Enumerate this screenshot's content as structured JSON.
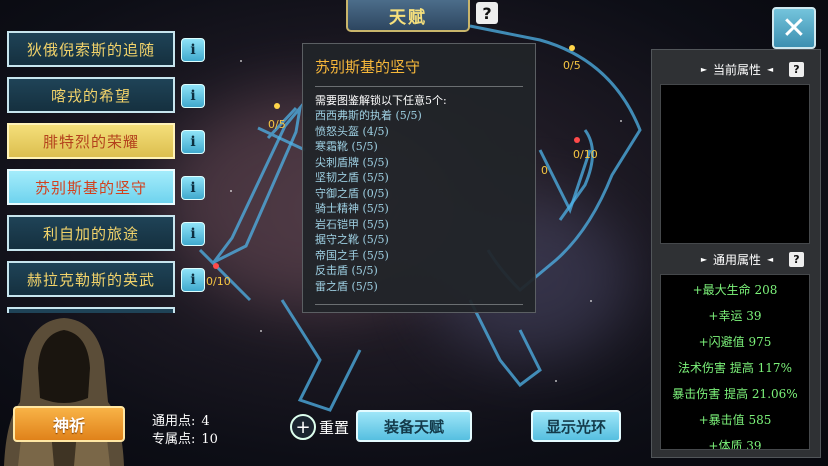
{
  "header": {
    "title": "天赋",
    "help_icon": "question-icon"
  },
  "close_icon": "close-icon",
  "talents": [
    {
      "label": "狄俄倪索斯的追随",
      "style": "normal"
    },
    {
      "label": "喀戎的希望",
      "style": "normal"
    },
    {
      "label": "腓特烈的荣耀",
      "style": "gold"
    },
    {
      "label": "苏别斯基的坚守",
      "style": "cyan"
    },
    {
      "label": "利自加的旅途",
      "style": "normal"
    },
    {
      "label": "赫拉克勒斯的英武",
      "style": "normal"
    }
  ],
  "info_label": "i",
  "constellation_points": {
    "top": "0/5",
    "left_upper": "0/5",
    "right": "0/10",
    "right_mid": "0",
    "left_lower": "0/10"
  },
  "popup": {
    "title": "苏别斯基的坚守",
    "requirement": "需要图鉴解锁以下任意5个:",
    "items": [
      "西西弗斯的执着 (5/5)",
      "愤怒头盔 (4/5)",
      "寒霜靴 (5/5)",
      "尖刺盾牌 (5/5)",
      "坚韧之盾 (5/5)",
      "守御之盾 (0/5)",
      "骑士精神 (5/5)",
      "岩石铠甲 (5/5)",
      "据守之靴 (5/5)",
      "帝国之手 (5/5)",
      "反击盾 (5/5)",
      "雷之盾 (5/5)"
    ]
  },
  "right_panel": {
    "current_attr_title": "当前属性",
    "general_attr_title": "通用属性",
    "stats": [
      "+最大生命 208",
      "+幸运 39",
      "+闪避值 975",
      "法术伤害 提高 117%",
      "暴击伤害 提高 21.06%",
      "+暴击值 585",
      "+体质 39"
    ]
  },
  "bottom": {
    "pray_label": "神祈",
    "general_points_label": "通用点:",
    "general_points_value": "4",
    "special_points_label": "专属点:",
    "special_points_value": "10",
    "reset_label": "重置",
    "equip_label": "装备天赋",
    "show_aura_label": "显示光环"
  },
  "colors": {
    "accent_gold": "#f6e07c",
    "stat_green": "#7cf27a",
    "popup_title": "#f6b73a",
    "item_blue": "#9ed0e3"
  }
}
